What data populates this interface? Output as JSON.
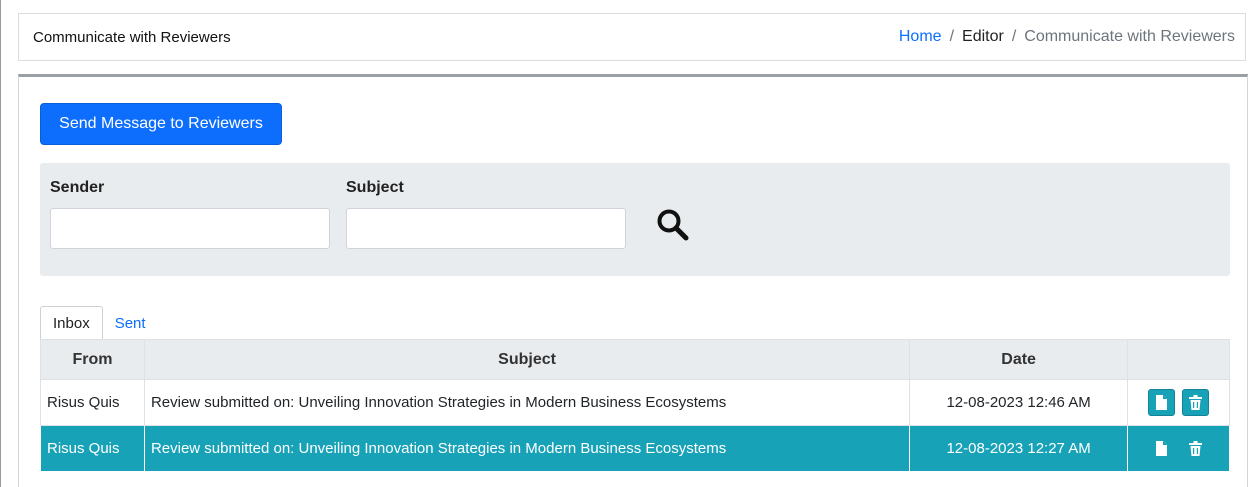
{
  "header": {
    "title": "Communicate with Reviewers",
    "breadcrumb": {
      "home": "Home",
      "separator": "/",
      "editor": "Editor",
      "current": "Communicate with Reviewers"
    }
  },
  "actions": {
    "send_label": "Send Message to Reviewers"
  },
  "filters": {
    "sender_label": "Sender",
    "sender_value": "",
    "subject_label": "Subject",
    "subject_value": "",
    "search_icon": "search-icon"
  },
  "tabs": [
    {
      "label": "Inbox",
      "active": true
    },
    {
      "label": "Sent",
      "active": false
    }
  ],
  "table": {
    "columns": [
      "From",
      "Subject",
      "Date",
      ""
    ],
    "rows": [
      {
        "from": "Risus Quis",
        "subject": "Review submitted on: Unveiling Innovation Strategies in Modern Business Ecosystems",
        "date": "12-08-2023 12:46 AM",
        "selected": false
      },
      {
        "from": "Risus Quis",
        "subject": "Review submitted on: Unveiling Innovation Strategies in Modern Business Ecosystems",
        "date": "12-08-2023 12:27 AM",
        "selected": true
      }
    ]
  },
  "colors": {
    "primary": "#0d6efd",
    "teal": "#17a2b8",
    "panel": "#e9ecef"
  },
  "icons": {
    "view": "document-icon",
    "delete": "trash-icon"
  }
}
